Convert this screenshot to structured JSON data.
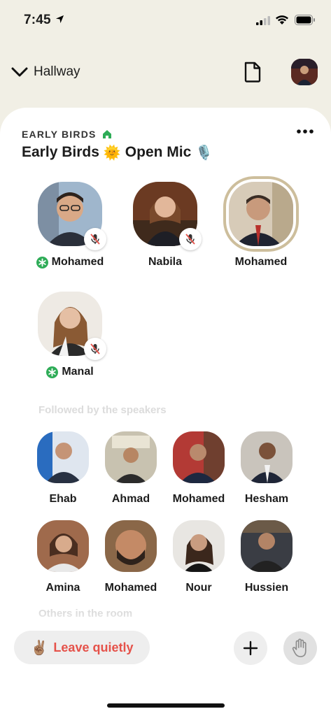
{
  "status_bar": {
    "time": "7:45"
  },
  "header": {
    "back_label": "Hallway"
  },
  "room": {
    "club_name": "EARLY BIRDS",
    "title": "Early Birds",
    "title_emoji_1": "🌞",
    "title_suffix": "Open Mic",
    "title_emoji_2": "🎙️"
  },
  "speakers": [
    {
      "name": "Mohamed",
      "moderator": true,
      "muted": true
    },
    {
      "name": "Nabila",
      "moderator": false,
      "muted": true
    },
    {
      "name": "Mohamed",
      "moderator": false,
      "muted": false,
      "speaking": true
    },
    {
      "name": "Manal",
      "moderator": true,
      "muted": true
    }
  ],
  "sections": {
    "followed": "Followed by the speakers",
    "others": "Others in the room"
  },
  "listeners": [
    {
      "name": "Ehab"
    },
    {
      "name": "Ahmad"
    },
    {
      "name": "Mohamed"
    },
    {
      "name": "Hesham"
    },
    {
      "name": "Amina"
    },
    {
      "name": "Mohamed"
    },
    {
      "name": "Nour"
    },
    {
      "name": "Hussien"
    }
  ],
  "bottom_bar": {
    "leave_emoji": "✌🏽",
    "leave_label": "Leave quietly"
  },
  "colors": {
    "background": "#F1EFE5",
    "leave_text": "#E5524A",
    "moderator_green": "#2EAC57",
    "speaking_ring": "#CDBE9C"
  }
}
